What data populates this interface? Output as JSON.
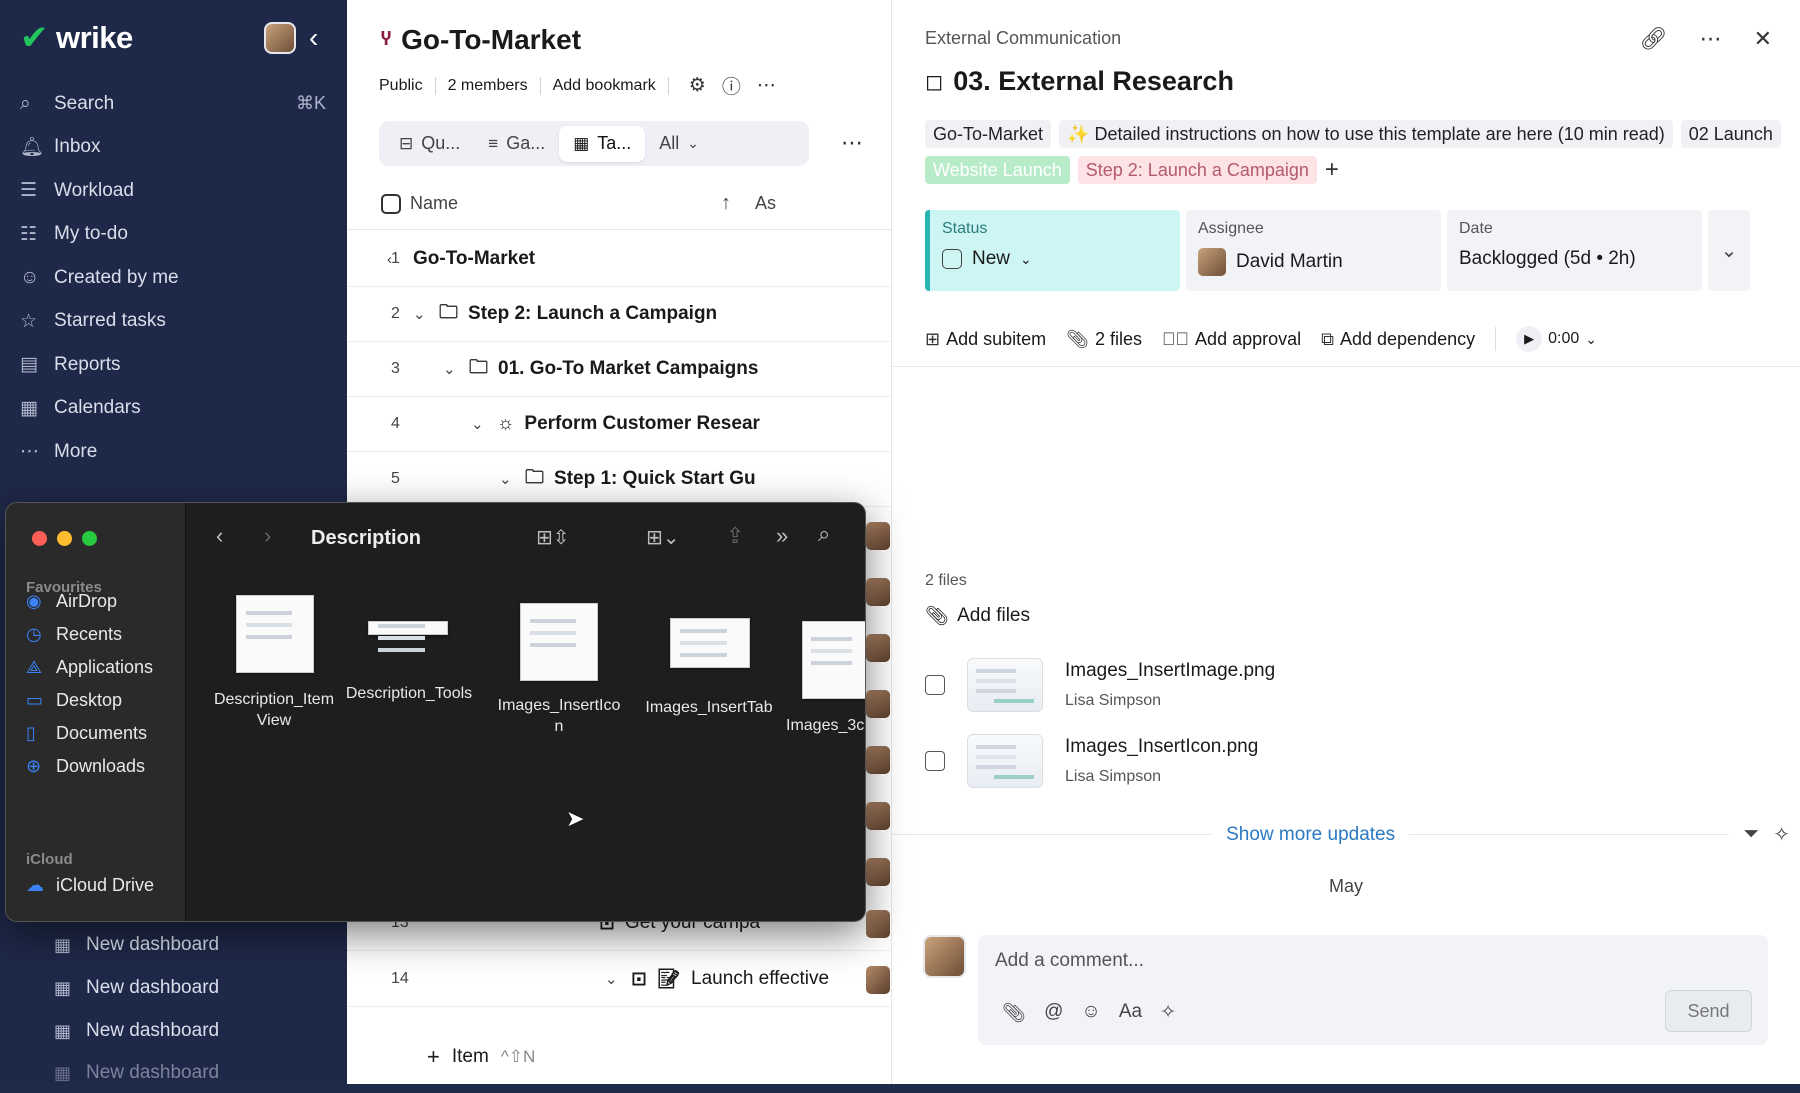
{
  "sidebar": {
    "logo": "wrike",
    "collapse_label": "‹",
    "nav": [
      {
        "icon": "search-icon",
        "glyph": "⌕",
        "label": "Search",
        "shortcut": "⌘K"
      },
      {
        "icon": "bell-icon",
        "glyph": "🔔︎",
        "label": "Inbox",
        "shortcut": ""
      },
      {
        "icon": "workload-icon",
        "glyph": "☰",
        "label": "Workload",
        "shortcut": ""
      },
      {
        "icon": "todo-icon",
        "glyph": "☷",
        "label": "My to-do",
        "shortcut": ""
      },
      {
        "icon": "person-icon",
        "glyph": "☺",
        "label": "Created by me",
        "shortcut": ""
      },
      {
        "icon": "star-icon",
        "glyph": "☆",
        "label": "Starred tasks",
        "shortcut": ""
      },
      {
        "icon": "report-icon",
        "glyph": "▤",
        "label": "Reports",
        "shortcut": ""
      },
      {
        "icon": "calendar-icon",
        "glyph": "▦",
        "label": "Calendars",
        "shortcut": ""
      },
      {
        "icon": "more-icon",
        "glyph": "⋯",
        "label": "More",
        "shortcut": ""
      }
    ],
    "dashboards": [
      "New dashboard",
      "New dashboard",
      "New dashboard",
      "New dashboard"
    ]
  },
  "project": {
    "title": "Go-To-Market",
    "public_label": "Public",
    "members_label": "2 members",
    "bookmark_label": "Add bookmark",
    "views": [
      {
        "icon": "queue-icon",
        "glyph": "⊟",
        "label": "Qu..."
      },
      {
        "icon": "gantt-icon",
        "glyph": "≡",
        "label": "Ga..."
      },
      {
        "icon": "table-icon",
        "glyph": "▦",
        "label": "Ta..."
      }
    ],
    "filter_label": "All",
    "column_name": "Name",
    "column_assignee": "As",
    "rows": [
      {
        "num": "1",
        "label": "Go-To-Market",
        "chev": "‹",
        "icon": ""
      },
      {
        "num": "2",
        "label": "Step 2: Launch a Campaign",
        "chev": "⌄",
        "icon": "🗀"
      },
      {
        "num": "3",
        "label": "01. Go-To Market Campaigns",
        "chev": "⌄",
        "icon": "🗀"
      },
      {
        "num": "4",
        "label": "Perform Customer Resear",
        "chev": "⌄",
        "icon": "☼"
      },
      {
        "num": "5",
        "label": "Step 1: Quick Start Gu",
        "chev": "⌄",
        "icon": "🗀"
      }
    ],
    "row13": {
      "num": "13",
      "label": "Get your campa"
    },
    "row14": {
      "num": "14",
      "label": "Launch effective"
    },
    "add_item_label": "Item",
    "add_item_shortcut": "^⇧N"
  },
  "task": {
    "breadcrumb": "External Communication",
    "title": "03. External Research",
    "tags": [
      {
        "label": "Go-To-Market",
        "style": "default"
      },
      {
        "label": "✨ Detailed instructions on how to use this template are here (10 min read)",
        "style": "default"
      },
      {
        "label": "02 Launch",
        "style": "default"
      },
      {
        "label": "Website Launch",
        "style": "green"
      },
      {
        "label": "Step 2: Launch a Campaign",
        "style": "pink"
      }
    ],
    "status_label": "Status",
    "status_value": "New",
    "assignee_label": "Assignee",
    "assignee_value": "David Martin",
    "date_label": "Date",
    "date_value": "Backlogged (5d • 2h)",
    "actions": {
      "add_subitem": "Add subitem",
      "files": "2 files",
      "add_approval": "Add approval",
      "add_dependency": "Add dependency",
      "timer": "0:00"
    },
    "files_count_label": "2 files",
    "add_files_label": "Add files",
    "files": [
      {
        "name": "Images_InsertImage.png",
        "by": "Lisa Simpson"
      },
      {
        "name": "Images_InsertIcon.png",
        "by": "Lisa Simpson"
      }
    ],
    "show_more": "Show more updates",
    "month": "May",
    "comment_placeholder": "Add a comment...",
    "send_label": "Send",
    "comment_tools": [
      "📎︎",
      "@",
      "☺",
      "Aa",
      "✧"
    ]
  },
  "finder": {
    "title": "Description",
    "favourites_label": "Favourites",
    "favourites": [
      {
        "icon": "airdrop-icon",
        "glyph": "◉",
        "label": "AirDrop"
      },
      {
        "icon": "recents-icon",
        "glyph": "◷",
        "label": "Recents"
      },
      {
        "icon": "applications-icon",
        "glyph": "⟁",
        "label": "Applications"
      },
      {
        "icon": "desktop-icon",
        "glyph": "▭",
        "label": "Desktop"
      },
      {
        "icon": "documents-icon",
        "glyph": "▯",
        "label": "Documents"
      },
      {
        "icon": "downloads-icon",
        "glyph": "⊕",
        "label": "Downloads"
      }
    ],
    "icloud_label": "iCloud",
    "icloud_drive": "iCloud Drive",
    "files": [
      {
        "label": "Description_Item\nView"
      },
      {
        "label": "Description_Tools"
      },
      {
        "label": "Images_InsertIco\nn"
      },
      {
        "label": "Images_InsertTab"
      },
      {
        "label": "Images_3c"
      }
    ]
  },
  "colors": {
    "sidebar": "#1e2848",
    "accent_green": "#22c55e",
    "status_teal": "#cdf5f4",
    "link_blue": "#2b79c2"
  }
}
